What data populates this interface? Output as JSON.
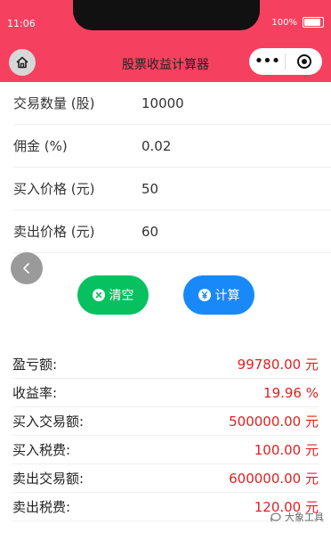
{
  "status_bar": {
    "time": "11:06",
    "battery": "100%"
  },
  "nav": {
    "title": "股票收益计算器"
  },
  "form": {
    "rows": [
      {
        "label": "交易数量 (股)",
        "value": "10000"
      },
      {
        "label": "佣金 (%)",
        "value": "0.02"
      },
      {
        "label": "买入价格 (元)",
        "value": "50"
      },
      {
        "label": "卖出价格 (元)",
        "value": "60"
      }
    ]
  },
  "buttons": {
    "clear": "清空",
    "calculate": "计算"
  },
  "results": {
    "rows": [
      {
        "label": "盈亏额:",
        "value": "99780.00 元"
      },
      {
        "label": "收益率:",
        "value": "19.96 %"
      },
      {
        "label": "买入交易额:",
        "value": "500000.00 元"
      },
      {
        "label": "买入税费:",
        "value": "100.00 元"
      },
      {
        "label": "卖出交易额:",
        "value": "600000.00 元"
      },
      {
        "label": "卖出税费:",
        "value": "120.00 元"
      }
    ]
  },
  "watermark": {
    "text": "大象工具"
  },
  "colors": {
    "header": "#f6405f",
    "clear": "#07c160",
    "calculate": "#1989fa",
    "result": "#e02020"
  }
}
